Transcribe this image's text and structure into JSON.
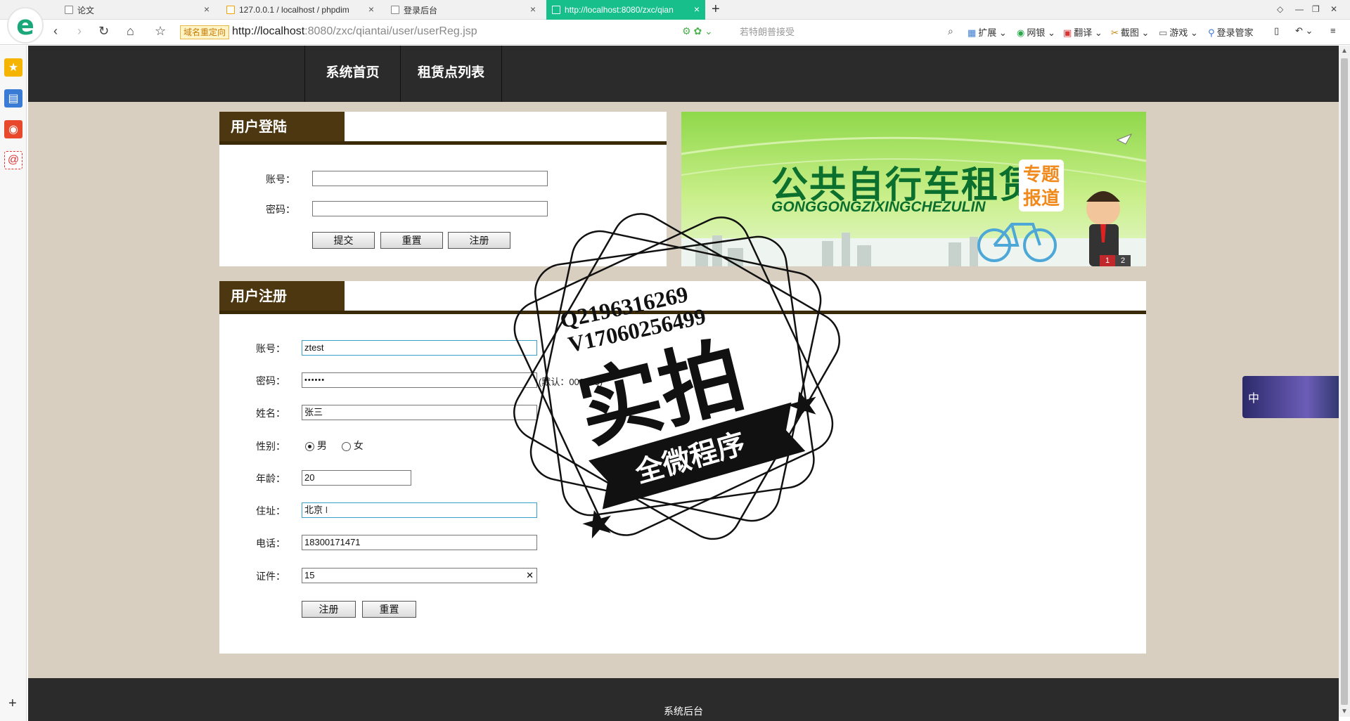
{
  "browser": {
    "tabs": [
      {
        "label": "论文"
      },
      {
        "label": "127.0.0.1 / localhost / phpdim"
      },
      {
        "label": "登录后台"
      },
      {
        "label": "http://localhost:8080/zxc/qian"
      }
    ],
    "redirect_badge": "域名重定向",
    "url_host": "http://localhost",
    "url_rest": ":8080/zxc/qiantai/user/userReg.jsp",
    "search_placeholder": "若特朗普接受",
    "toolbar": {
      "extensions": "扩展",
      "netbank": "网银",
      "translate": "翻译",
      "screenshot": "截图",
      "games": "游戏",
      "login_manager": "登录管家"
    }
  },
  "nav": {
    "items": [
      {
        "label": "系统首页"
      },
      {
        "label": "租赁点列表"
      }
    ]
  },
  "login": {
    "title": "用户登陆",
    "account_label": "账号：",
    "password_label": "密码：",
    "submit": "提交",
    "reset": "重置",
    "register": "注册"
  },
  "banner": {
    "title": "公共自行车租赁",
    "pinyin": "GONGGONGZIXINGCHEZULIN",
    "tag": "专题报道",
    "pages": [
      "1",
      "2"
    ]
  },
  "register": {
    "title": "用户注册",
    "fields": {
      "account": {
        "label": "账号：",
        "value": "ztest"
      },
      "password": {
        "label": "密码：",
        "value": "••••••",
        "hint": "(默认：000000)"
      },
      "name": {
        "label": "姓名：",
        "value": "张三"
      },
      "gender": {
        "label": "性别：",
        "male": "男",
        "female": "女",
        "selected": "男"
      },
      "age": {
        "label": "年龄：",
        "value": "20"
      },
      "address": {
        "label": "住址：",
        "value": "北京"
      },
      "phone": {
        "label": "电话：",
        "value": "18300171471"
      },
      "id_card": {
        "label": "证件：",
        "value": "15"
      }
    },
    "submit": "注册",
    "reset": "重置"
  },
  "watermark": {
    "qq": "Q2196316269",
    "vx": "V17060256499",
    "big": "实拍",
    "ribbon": "全微程序"
  },
  "float_widget": {
    "text": "中"
  },
  "footer": {
    "text": "系统后台"
  }
}
